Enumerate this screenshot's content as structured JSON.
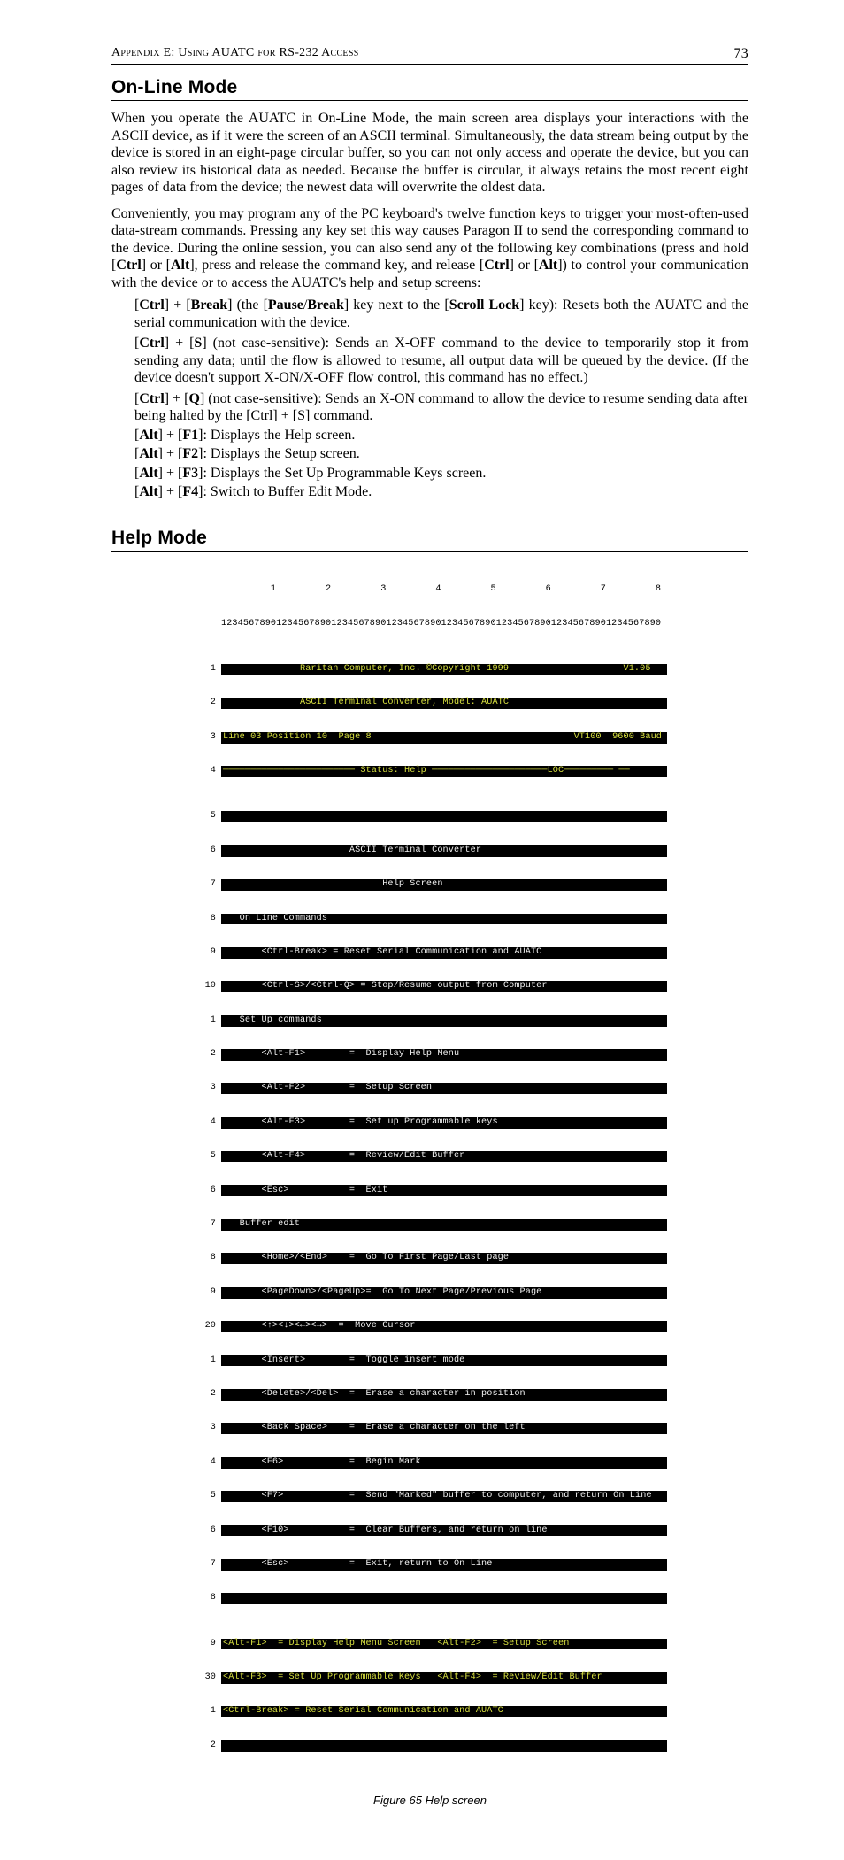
{
  "header": {
    "label": "Appendix E: Using AUATC for RS-232 Access",
    "page": "73"
  },
  "section1": {
    "title": "On-Line Mode",
    "para1": "When you operate the AUATC in On-Line Mode, the main screen area displays your interactions with the ASCII device, as if it were the screen of an ASCII terminal. Simultaneously, the data stream being output by the device is stored in an eight-page circular buffer, so you can not only access and operate the device, but you can also review its historical data as needed. Because the buffer is circular, it always retains the most recent eight pages of data from the device; the newest data will overwrite the oldest data.",
    "para2_pre": "Conveniently, you may program any of the PC keyboard's twelve function keys to trigger your most-often-used data-stream commands. Pressing any key set this way causes Paragon II to send the corresponding command to the device. During the online session, you can also send any of the following key combinations (press and hold [",
    "para2_b1": "Ctrl",
    "para2_mid1": "] or [",
    "para2_b2": "Alt",
    "para2_mid2": "], press and release the command key, and release [",
    "para2_b3": "Ctrl",
    "para2_mid3": "] or [",
    "para2_b4": "Alt",
    "para2_end": "]) to control your communication with the device or to access the AUATC's help and setup screens:",
    "items": {
      "i1_a": "[",
      "i1_b1": "Ctrl",
      "i1_c": "] + [",
      "i1_b2": "Break",
      "i1_d": "] (the [",
      "i1_b3": "Pause",
      "i1_e": "/",
      "i1_b4": "Break",
      "i1_f": "] key next to the [",
      "i1_b5": "Scroll Lock",
      "i1_g": "] key): Resets both the AUATC and the serial communication with the device.",
      "i2_a": "[",
      "i2_b1": "Ctrl",
      "i2_c": "] + [",
      "i2_b2": "S",
      "i2_d": "] (not case-sensitive): Sends an X-OFF command to the device to temporarily stop it from sending any data; until the flow is allowed to resume, all output data will be queued by the device. (If the device doesn't support X-ON/X-OFF flow control, this command has no effect.)",
      "i3_a": "[",
      "i3_b1": "Ctrl",
      "i3_c": "] + [",
      "i3_b2": "Q",
      "i3_d": "] (not case-sensitive): Sends an X-ON command to allow the device to resume sending data after being halted by the [Ctrl] + [S] command.",
      "i4_a": "[",
      "i4_b1": "Alt",
      "i4_c": "] + [",
      "i4_b2": "F1",
      "i4_d": "]: Displays the Help screen.",
      "i5_a": "[",
      "i5_b1": "Alt",
      "i5_c": "] + [",
      "i5_b2": "F2",
      "i5_d": "]: Displays the Setup screen.",
      "i6_a": "[",
      "i6_b1": "Alt",
      "i6_c": "] + [",
      "i6_b2": "F3",
      "i6_d": "]: Displays the Set Up Programmable Keys screen.",
      "i7_a": "[",
      "i7_b1": "Alt",
      "i7_c": "] + [",
      "i7_b2": "F4",
      "i7_d": "]: Switch to Buffer Edit Mode."
    }
  },
  "section2": {
    "title": "Help Mode",
    "caption": "Figure 65 Help screen"
  },
  "terminal": {
    "ruler_nums": "         1         2         3         4         5         6         7         8",
    "ruler_ticks": "12345678901234567890123456789012345678901234567890123456789012345678901234567890",
    "gutters": [
      "1",
      "2",
      "3",
      "4",
      "5",
      "6",
      "7",
      "8",
      "9",
      "10",
      "1",
      "2",
      "3",
      "4",
      "5",
      "6",
      "7",
      "8",
      "9",
      "20",
      "1",
      "2",
      "3",
      "4",
      "5",
      "6",
      "7",
      "8",
      "9",
      "30",
      "1",
      "2"
    ],
    "y1_left": "              Raritan Computer, Inc. ©Copyright 1999",
    "y1_right": "V1.05  ",
    "y2": "              ASCII Terminal Converter, Model: AUATC",
    "y3_left": "Line 03 Position 10  Page 8",
    "y3_right": "VT100  9600 Baud",
    "y4": "──────────────────────── Status: Help ─────────────────────LOC───────── ──",
    "w": [
      "",
      "                       ASCII Terminal Converter",
      "                             Help Screen",
      "   On Line Commands",
      "       <Ctrl-Break> = Reset Serial Communication and AUATC",
      "       <Ctrl-S>/<Ctrl-Q> = Stop/Resume output from Computer",
      "   Set Up commands",
      "       <Alt-F1>        =  Display Help Menu",
      "       <Alt-F2>        =  Setup Screen",
      "       <Alt-F3>        =  Set up Programmable keys",
      "       <Alt-F4>        =  Review/Edit Buffer",
      "       <Esc>           =  Exit",
      "   Buffer edit",
      "       <Home>/<End>    =  Go To First Page/Last page",
      "       <PageDown>/<PageUp>=  Go To Next Page/Previous Page",
      "       <↑><↓><←><→>  =  Move Cursor",
      "       <Insert>        =  Toggle insert mode",
      "       <Delete>/<Del>  =  Erase a character in position",
      "       <Back Space>    =  Erase a character on the left",
      "       <F6>            =  Begin Mark",
      "       <F7>            =  Send \"Marked\" buffer to computer, and return On Line",
      "       <F10>           =  Clear Buffers, and return on line",
      "       <Esc>           =  Exit, return to On Line",
      ""
    ],
    "f1": "<Alt-F1>  = Display Help Menu Screen   <Alt-F2>  = Setup Screen",
    "f2": "<Alt-F3>  = Set Up Programmable Keys   <Alt-F4>  = Review/Edit Buffer",
    "f3": "<Ctrl-Break> = Reset Serial Communication and AUATC",
    "f4": ""
  }
}
